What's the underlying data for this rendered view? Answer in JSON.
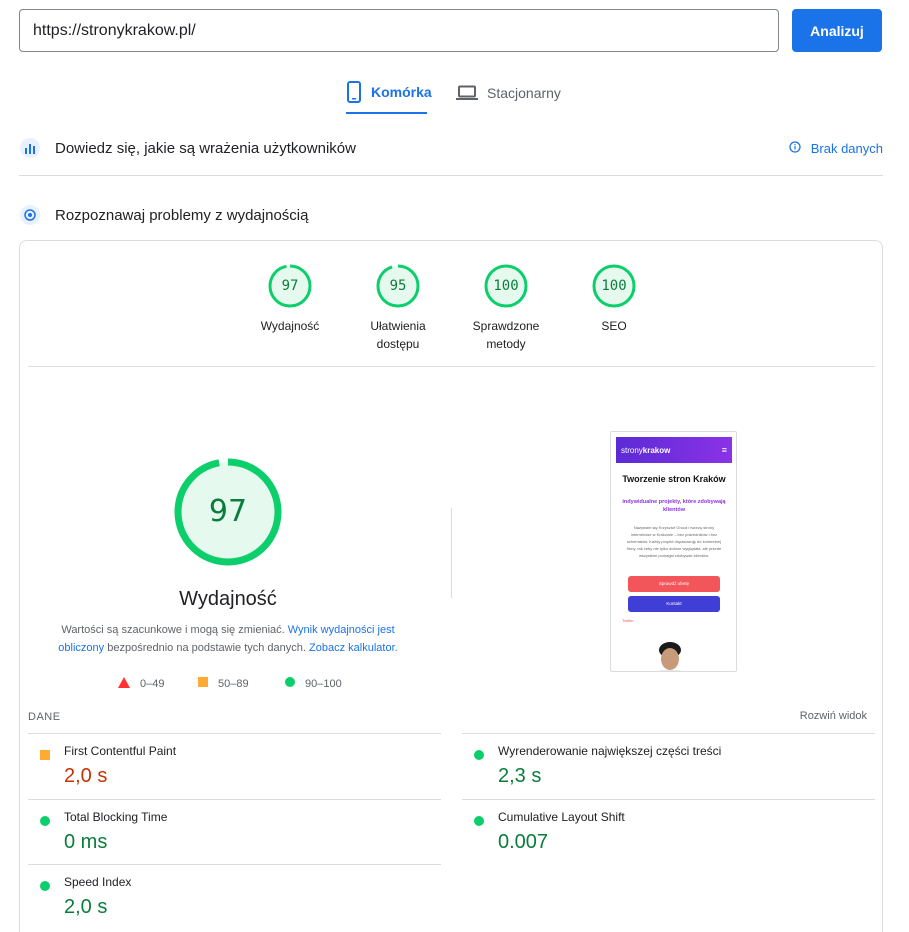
{
  "search": {
    "url": "https://stronykrakow.pl/",
    "button_label": "Analizuj"
  },
  "tabs": [
    {
      "label": "Komórka",
      "active": true,
      "icon": "phone-icon"
    },
    {
      "label": "Stacjonarny",
      "active": false,
      "icon": "laptop-icon"
    }
  ],
  "sections": {
    "field_title": "Dowiedz się, jakie są wrażenia użytkowników",
    "no_data_label": "Brak danych",
    "lab_title": "Rozpoznawaj problemy z wydajnością"
  },
  "categories": [
    {
      "score": "97",
      "label": "Wydajność"
    },
    {
      "score": "95",
      "label": "Ułatwienia dostępu"
    },
    {
      "score": "100",
      "label": "Sprawdzone metody"
    },
    {
      "score": "100",
      "label": "SEO"
    }
  ],
  "performance": {
    "score": "97",
    "score_fraction": 0.97,
    "label": "Wydajność",
    "desc_start": "Wartości są szacunkowe i mogą się zmieniać.",
    "desc_link1": "Wynik wydajności jest obliczony",
    "desc_mid": "bezpośrednio na podstawie tych danych.",
    "desc_link2": "Zobacz kalkulator."
  },
  "legend": [
    {
      "label": "0–49",
      "color": "#ff3333",
      "shape": "triangle"
    },
    {
      "label": "50–89",
      "color": "#ffaa33",
      "shape": "square"
    },
    {
      "label": "90–100",
      "color": "#0cce6b",
      "shape": "circle"
    }
  ],
  "screenshot": {
    "brand_1": "strony",
    "brand_2": "krakow",
    "title": "Tworzenie stron Kraków",
    "subtitle": "indywidualne projekty, które zdobywają klientów",
    "text": "Nazywam się Krzysztof Gruca i tworzę strony internetowe w Krakowie – bez pośredników i bez schematów. Każdy projekt dopasowuję do konkretnej firmy, tak żeby nie tylko dobrze wyglądała, ale przede wszystkim pomagał zdobywać klientów.",
    "button1": "Sprawdź ofertę",
    "button2": "Kontakt",
    "link": "Twitter"
  },
  "dane": {
    "label": "DANE",
    "expand_label": "Rozwiń widok"
  },
  "metrics": [
    {
      "name": "First Contentful Paint",
      "value": "2,0 s",
      "status": "orange"
    },
    {
      "name": "Wyrenderowanie największej części treści",
      "value": "2,3 s",
      "status": "green"
    },
    {
      "name": "Total Blocking Time",
      "value": "0 ms",
      "status": "green"
    },
    {
      "name": "Cumulative Layout Shift",
      "value": "0.007",
      "status": "green"
    },
    {
      "name": "Speed Index",
      "value": "2,0 s",
      "status": "green"
    }
  ],
  "colors": {
    "accent": "#1a73e8",
    "good": "#0cce6b",
    "good_text": "#0a7d3b",
    "average": "#ffa400",
    "average_text": "#c33300"
  }
}
